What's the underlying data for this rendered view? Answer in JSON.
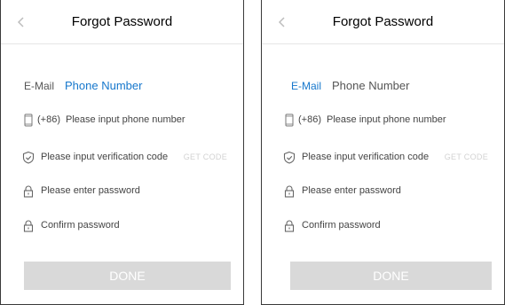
{
  "panels": [
    {
      "title": "Forgot Password",
      "tabs": [
        {
          "label": "E-Mail",
          "active": false
        },
        {
          "label": "Phone Number",
          "active": true
        }
      ],
      "phone": {
        "prefix": "(+86)",
        "placeholder": "Please input phone number",
        "icon": "phone-icon"
      },
      "code": {
        "placeholder": "Please input verification code",
        "button": "GET CODE",
        "icon": "shield-check-icon"
      },
      "password": {
        "placeholder": "Please enter password",
        "icon": "lock-icon"
      },
      "confirm": {
        "placeholder": "Confirm password",
        "icon": "lock-icon"
      },
      "done": "DONE"
    },
    {
      "title": "Forgot Password",
      "tabs": [
        {
          "label": "E-Mail",
          "active": true
        },
        {
          "label": "Phone Number",
          "active": false
        }
      ],
      "phone": {
        "prefix": "(+86)",
        "placeholder": "Please input phone number",
        "icon": "phone-icon"
      },
      "code": {
        "placeholder": "Please input verification code",
        "button": "GET CODE",
        "icon": "shield-check-icon"
      },
      "password": {
        "placeholder": "Please enter password",
        "icon": "lock-icon"
      },
      "confirm": {
        "placeholder": "Confirm password",
        "icon": "lock-icon"
      },
      "done": "DONE"
    }
  ],
  "colors": {
    "accent": "#1677cc",
    "disabled_button": "#d9d9d9",
    "disabled_text": "#d2d2d2"
  }
}
